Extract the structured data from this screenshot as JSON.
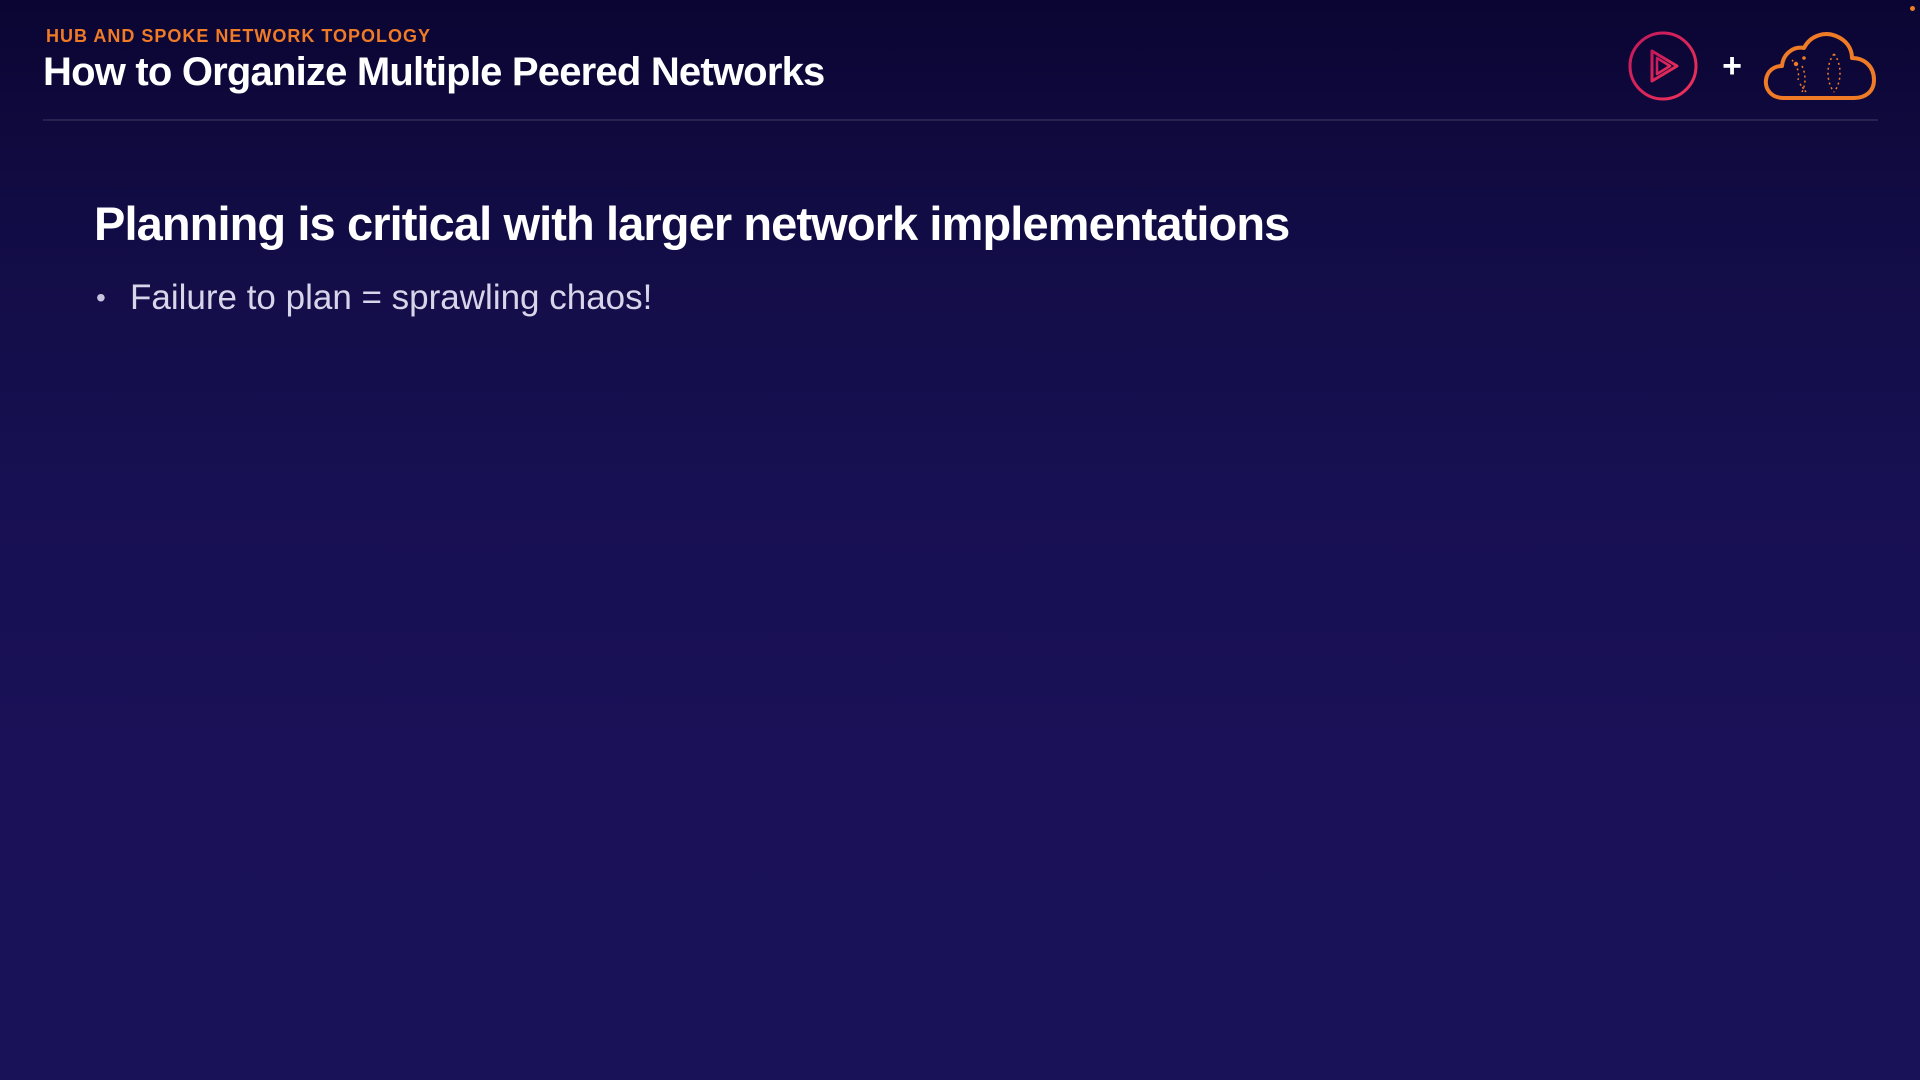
{
  "header": {
    "section_label": "HUB AND SPOKE NETWORK TOPOLOGY",
    "title": "How to Organize Multiple Peered Networks",
    "plus_symbol": "+",
    "logos": [
      {
        "icon": "play-icon",
        "color": "#e0245e"
      },
      {
        "icon": "cloud-icon",
        "color": "#f07b27"
      }
    ]
  },
  "main": {
    "heading": "Planning is critical with larger network implementations",
    "bullets": [
      {
        "marker": "•",
        "text": "Failure to plan = sprawling chaos!"
      }
    ]
  },
  "colors": {
    "accent": "#f07b27",
    "brand_pink": "#e0245e",
    "background_top": "#0b0533",
    "background_bottom": "#1a1259"
  }
}
